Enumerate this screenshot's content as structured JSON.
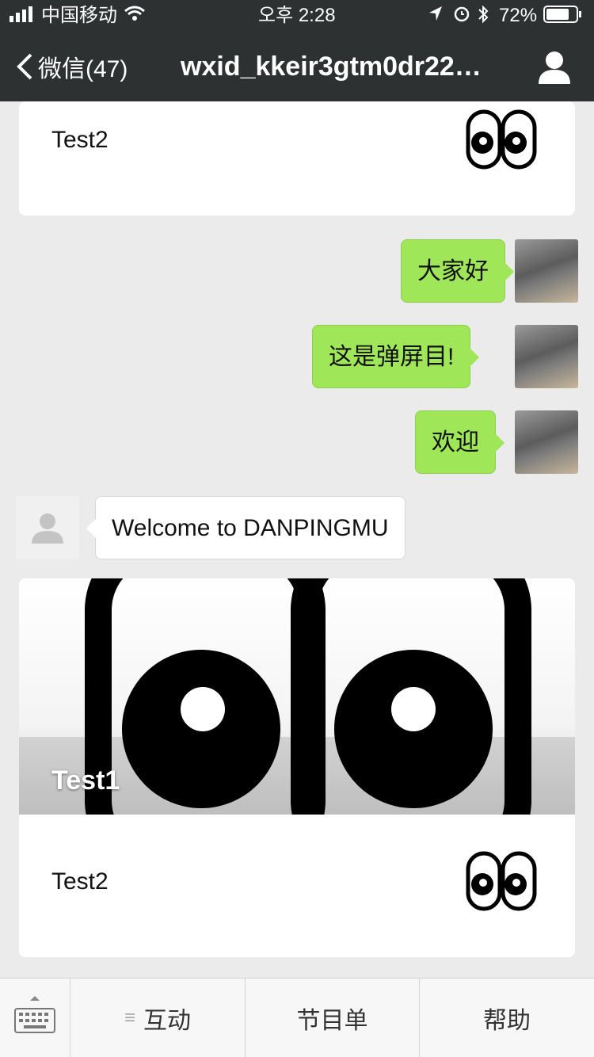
{
  "status_bar": {
    "carrier": "中国移动",
    "time": "오후 2:28",
    "battery": "72%"
  },
  "nav": {
    "back_label": "微信(47)",
    "title": "wxid_kkeir3gtm0dr22…"
  },
  "cards": [
    {
      "text": "Test2",
      "icon": "eyes-emoji-icon"
    },
    {
      "banner_title": "Test1",
      "text": "Test2",
      "icon": "eyes-emoji-icon"
    }
  ],
  "messages": [
    {
      "side": "right",
      "text": "大家好"
    },
    {
      "side": "right",
      "text": "这是弹屏目!"
    },
    {
      "side": "right",
      "text": "欢迎"
    },
    {
      "side": "left",
      "text": "Welcome to DANPINGMU"
    }
  ],
  "bottom_bar": {
    "tabs": [
      {
        "label": "互动",
        "icon": "menu-icon"
      },
      {
        "label": "节目单"
      },
      {
        "label": "帮助"
      }
    ]
  },
  "colors": {
    "nav_bg": "#2e3132",
    "chat_bg": "#ebebeb",
    "bubble_green": "#9fe658"
  }
}
